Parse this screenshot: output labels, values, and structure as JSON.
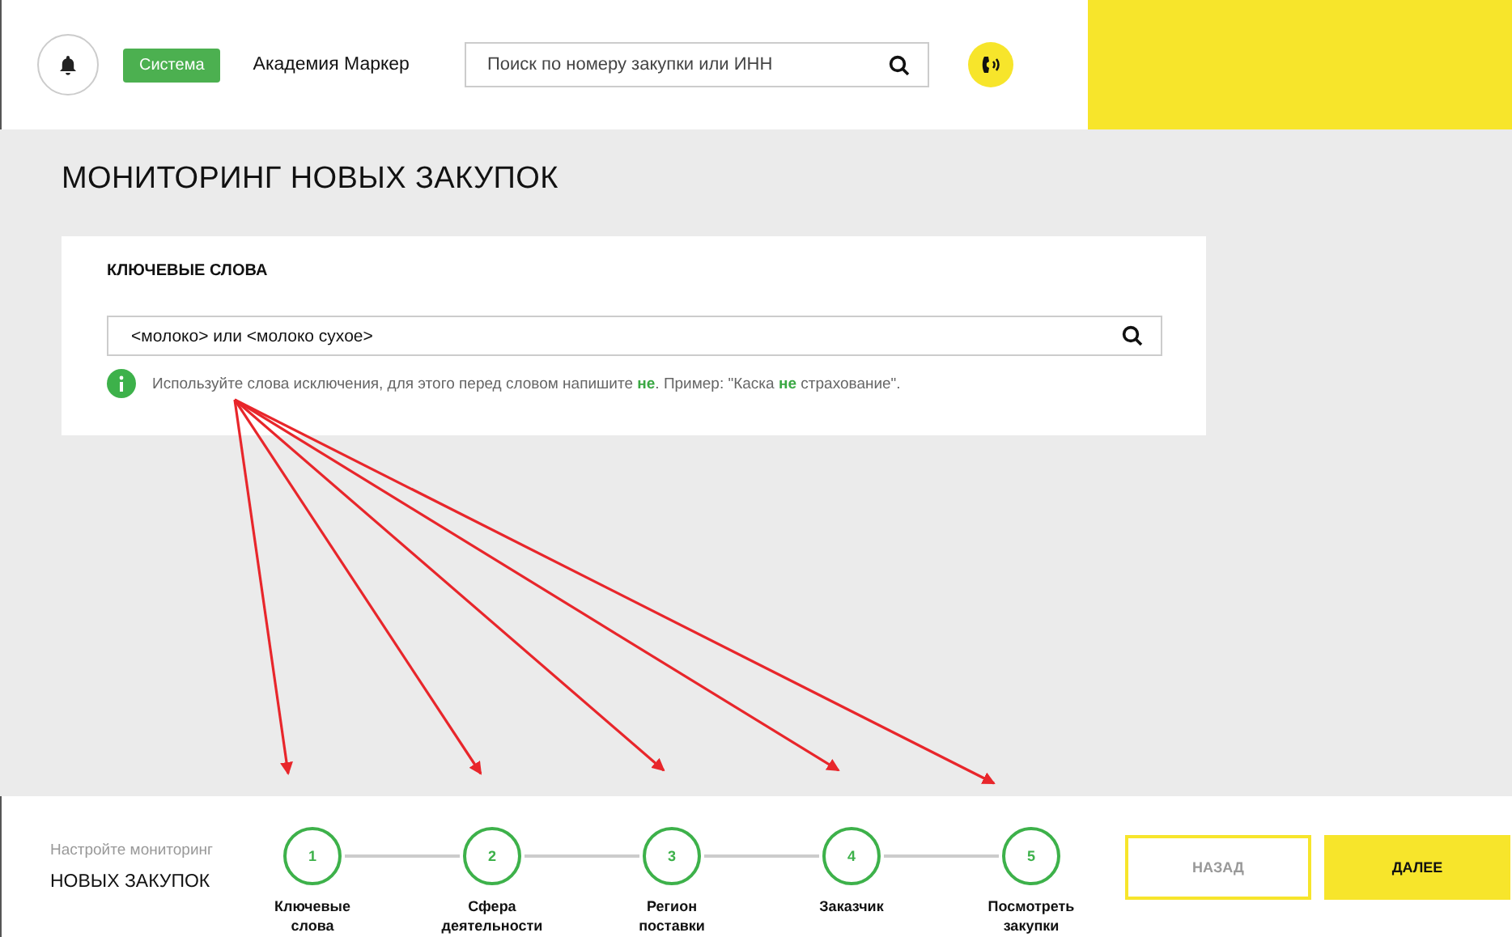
{
  "header": {
    "badge": "Система",
    "company": "Академия Маркер",
    "search": {
      "placeholder": "Поиск по номеру закупки или ИНН"
    }
  },
  "page_title": "МОНИТОРИНГ НОВЫХ ЗАКУПОК",
  "keywords": {
    "title": "КЛЮЧЕВЫЕ СЛОВА",
    "value": "<молоко> или <молоко сухое>",
    "hint": "Используйте слова исключения, для этого перед словом напишите **не**. Пример: \"Каска **не** страхование\"."
  },
  "footer": {
    "caption": "Настройте мониторинг",
    "subtitle": "НОВЫХ ЗАКУПОК",
    "steps": [
      {
        "number": "1",
        "label": "Ключевые слова"
      },
      {
        "number": "2",
        "label": "Сфера деятельности"
      },
      {
        "number": "3",
        "label": "Регион поставки"
      },
      {
        "number": "4",
        "label": "Заказчик"
      },
      {
        "number": "5",
        "label": "Посмотреть закупки"
      }
    ],
    "back": "НАЗАД",
    "next": "ДАЛЕЕ"
  }
}
